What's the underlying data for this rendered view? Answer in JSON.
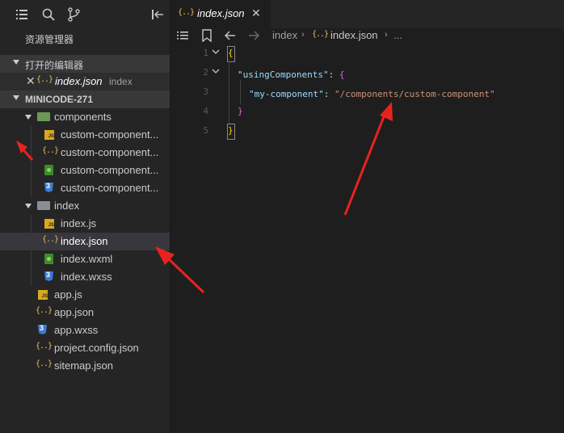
{
  "sidebar": {
    "explorer_title": "资源管理器",
    "open_editors_title": "打开的编辑器",
    "open_editor": {
      "name": "index.json",
      "folder": "index"
    },
    "project_title": "MINICODE-271",
    "tree": [
      {
        "label": "components",
        "type": "folder"
      },
      {
        "label": "custom-component...",
        "type": "js"
      },
      {
        "label": "custom-component...",
        "type": "json"
      },
      {
        "label": "custom-component...",
        "type": "wxml"
      },
      {
        "label": "custom-component...",
        "type": "wxss"
      },
      {
        "label": "index",
        "type": "folder"
      },
      {
        "label": "index.js",
        "type": "js"
      },
      {
        "label": "index.json",
        "type": "json"
      },
      {
        "label": "index.wxml",
        "type": "wxml"
      },
      {
        "label": "index.wxss",
        "type": "wxss"
      },
      {
        "label": "app.js",
        "type": "js"
      },
      {
        "label": "app.json",
        "type": "json"
      },
      {
        "label": "app.wxss",
        "type": "wxss"
      },
      {
        "label": "project.config.json",
        "type": "json"
      },
      {
        "label": "sitemap.json",
        "type": "json"
      }
    ]
  },
  "editor": {
    "tab_label": "index.json",
    "breadcrumb": {
      "folder": "index",
      "file": "index.json",
      "ellipsis": "..."
    },
    "line_numbers": [
      "1",
      "2",
      "3",
      "4",
      "5"
    ],
    "code": {
      "open_brace": "{",
      "key1": "\"usingComponents\"",
      "colon1": ": ",
      "brace2": "{",
      "key2": "\"my-component\"",
      "colon2": ": ",
      "value2": "\"/components/custom-component\"",
      "close_inner": "}",
      "close_outer": "}"
    }
  },
  "colors": {
    "accent_arrow": "#e8231e",
    "json_key": "#9cdcfe",
    "json_string": "#ce9178",
    "bracket_gold": "#ffd700",
    "bracket_purple": "#da70d6"
  }
}
